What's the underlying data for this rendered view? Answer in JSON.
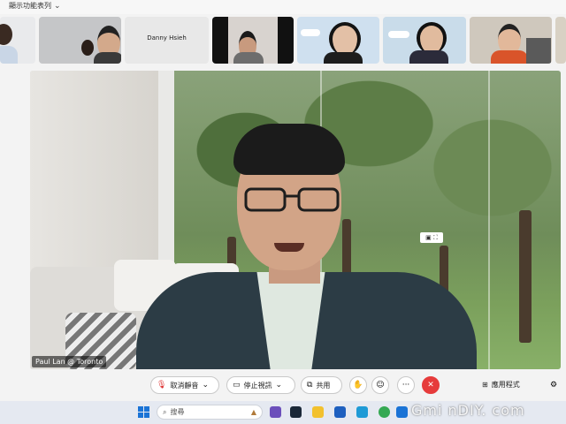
{
  "top_bar": {
    "view_toggle_label": "顯示功能表列"
  },
  "participants": [
    {
      "name": ""
    },
    {
      "name": ""
    },
    {
      "name": "Danny Hsieh"
    },
    {
      "name": ""
    },
    {
      "name": ""
    },
    {
      "name": ""
    },
    {
      "name": ""
    },
    {
      "name": ""
    }
  ],
  "main_video": {
    "speaker_label": "Paul Lan @ Toronto"
  },
  "controls": {
    "mute_label": "取消靜音",
    "video_label": "停止視訊",
    "share_label": "共用",
    "more_symbol": "···",
    "end_symbol": "✕",
    "apps_label": "應用程式"
  },
  "taskbar": {
    "search_label": "搜尋"
  },
  "watermark": "Gmi nDIY. com",
  "colors": {
    "end_call": "#e63b3b",
    "accent_blue": "#1a73d6"
  }
}
